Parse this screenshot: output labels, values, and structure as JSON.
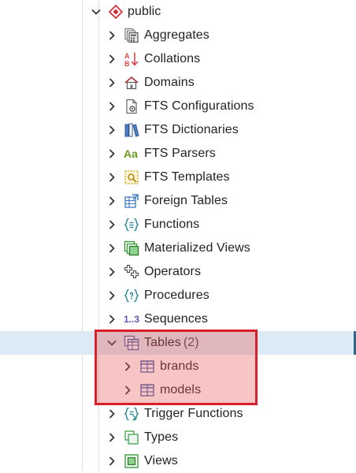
{
  "tree": {
    "schema": {
      "label": "public",
      "expanded": true
    },
    "nodes": [
      {
        "id": "aggregates",
        "label": "Aggregates",
        "icon": "aggregates-icon"
      },
      {
        "id": "collations",
        "label": "Collations",
        "icon": "collations-icon"
      },
      {
        "id": "domains",
        "label": "Domains",
        "icon": "domains-icon"
      },
      {
        "id": "fts-configurations",
        "label": "FTS Configurations",
        "icon": "fts-configurations-icon"
      },
      {
        "id": "fts-dictionaries",
        "label": "FTS Dictionaries",
        "icon": "fts-dictionaries-icon"
      },
      {
        "id": "fts-parsers",
        "label": "FTS Parsers",
        "icon": "fts-parsers-icon"
      },
      {
        "id": "fts-templates",
        "label": "FTS Templates",
        "icon": "fts-templates-icon"
      },
      {
        "id": "foreign-tables",
        "label": "Foreign Tables",
        "icon": "foreign-tables-icon"
      },
      {
        "id": "functions",
        "label": "Functions",
        "icon": "functions-icon"
      },
      {
        "id": "materialized-views",
        "label": "Materialized Views",
        "icon": "materialized-views-icon"
      },
      {
        "id": "operators",
        "label": "Operators",
        "icon": "operators-icon"
      },
      {
        "id": "procedures",
        "label": "Procedures",
        "icon": "procedures-icon"
      },
      {
        "id": "sequences",
        "label": "Sequences",
        "icon": "sequences-icon"
      },
      {
        "id": "tables",
        "label": "Tables",
        "count": "(2)",
        "icon": "tables-icon",
        "expanded": true,
        "selected": true,
        "children": [
          {
            "id": "brands",
            "label": "brands",
            "icon": "table-icon"
          },
          {
            "id": "models",
            "label": "models",
            "icon": "table-icon"
          }
        ]
      },
      {
        "id": "trigger-functions",
        "label": "Trigger Functions",
        "icon": "trigger-functions-icon"
      },
      {
        "id": "types",
        "label": "Types",
        "icon": "types-icon"
      },
      {
        "id": "views",
        "label": "Views",
        "icon": "views-icon"
      }
    ]
  },
  "glyphs": {
    "fts_parsers": "Aa",
    "sequences": "1..3"
  },
  "colors": {
    "selected_row_bg": "#dceaf5",
    "selected_accent": "#326690",
    "highlight_border": "#d9202a",
    "schema_icon": "#d9262e",
    "table_icon": "#3b62a8"
  }
}
